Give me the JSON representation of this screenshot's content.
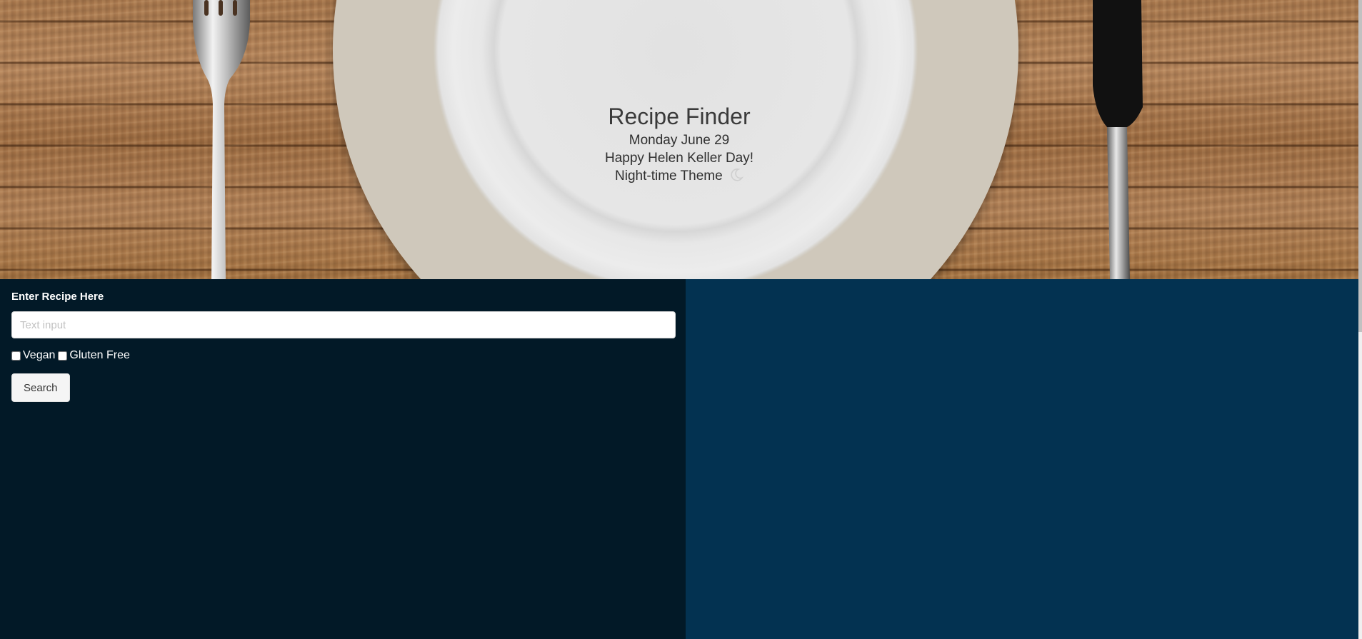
{
  "hero": {
    "title": "Recipe Finder",
    "date": "Monday June 29",
    "holiday": "Happy Helen Keller Day!",
    "theme_label": "Night-time Theme",
    "theme_icon": "moon-icon"
  },
  "form": {
    "label": "Enter Recipe Here",
    "input_placeholder": "Text input",
    "input_value": "",
    "options": [
      {
        "label": "Vegan",
        "checked": false
      },
      {
        "label": "Gluten Free",
        "checked": false
      }
    ],
    "search_label": "Search"
  },
  "colors": {
    "left_panel": "#021927",
    "right_panel": "#033251",
    "hero_text": "#333333"
  }
}
